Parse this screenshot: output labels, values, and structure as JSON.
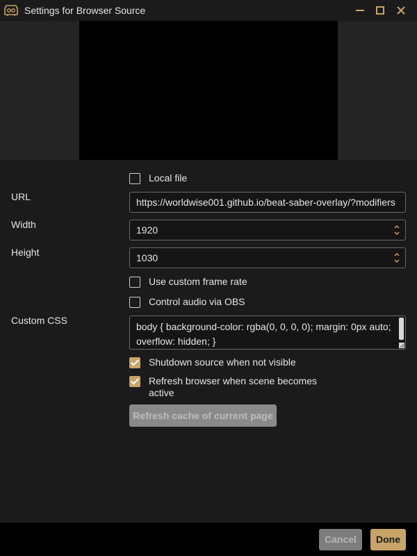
{
  "window": {
    "title": "Settings for Browser Source",
    "accent_color": "#c8a46a",
    "icons": {
      "app": "obs-logo-icon",
      "minimize": "minimize-icon",
      "maximize": "maximize-icon",
      "close": "close-icon"
    }
  },
  "form": {
    "local_file": {
      "label": "Local file",
      "checked": false
    },
    "url": {
      "label": "URL",
      "value": "https://worldwise001.github.io/beat-saber-overlay/?modifiers"
    },
    "width": {
      "label": "Width",
      "value": "1920"
    },
    "height": {
      "label": "Height",
      "value": "1030"
    },
    "custom_frame_rate": {
      "label": "Use custom frame rate",
      "checked": false
    },
    "control_audio": {
      "label": "Control audio via OBS",
      "checked": false
    },
    "custom_css": {
      "label": "Custom CSS",
      "line1": "body { background-color: rgba(0, 0, 0, 0); margin: 0px auto;",
      "line2": "overflow: hidden; }"
    },
    "shutdown_source": {
      "label": "Shutdown source when not visible",
      "checked": true
    },
    "refresh_browser": {
      "label_line1": "Refresh browser when scene becomes",
      "label_line2": "active",
      "checked": true
    },
    "refresh_cache_label": "Refresh cache of current page"
  },
  "footer": {
    "cancel_label": "Cancel",
    "done_label": "Done"
  }
}
